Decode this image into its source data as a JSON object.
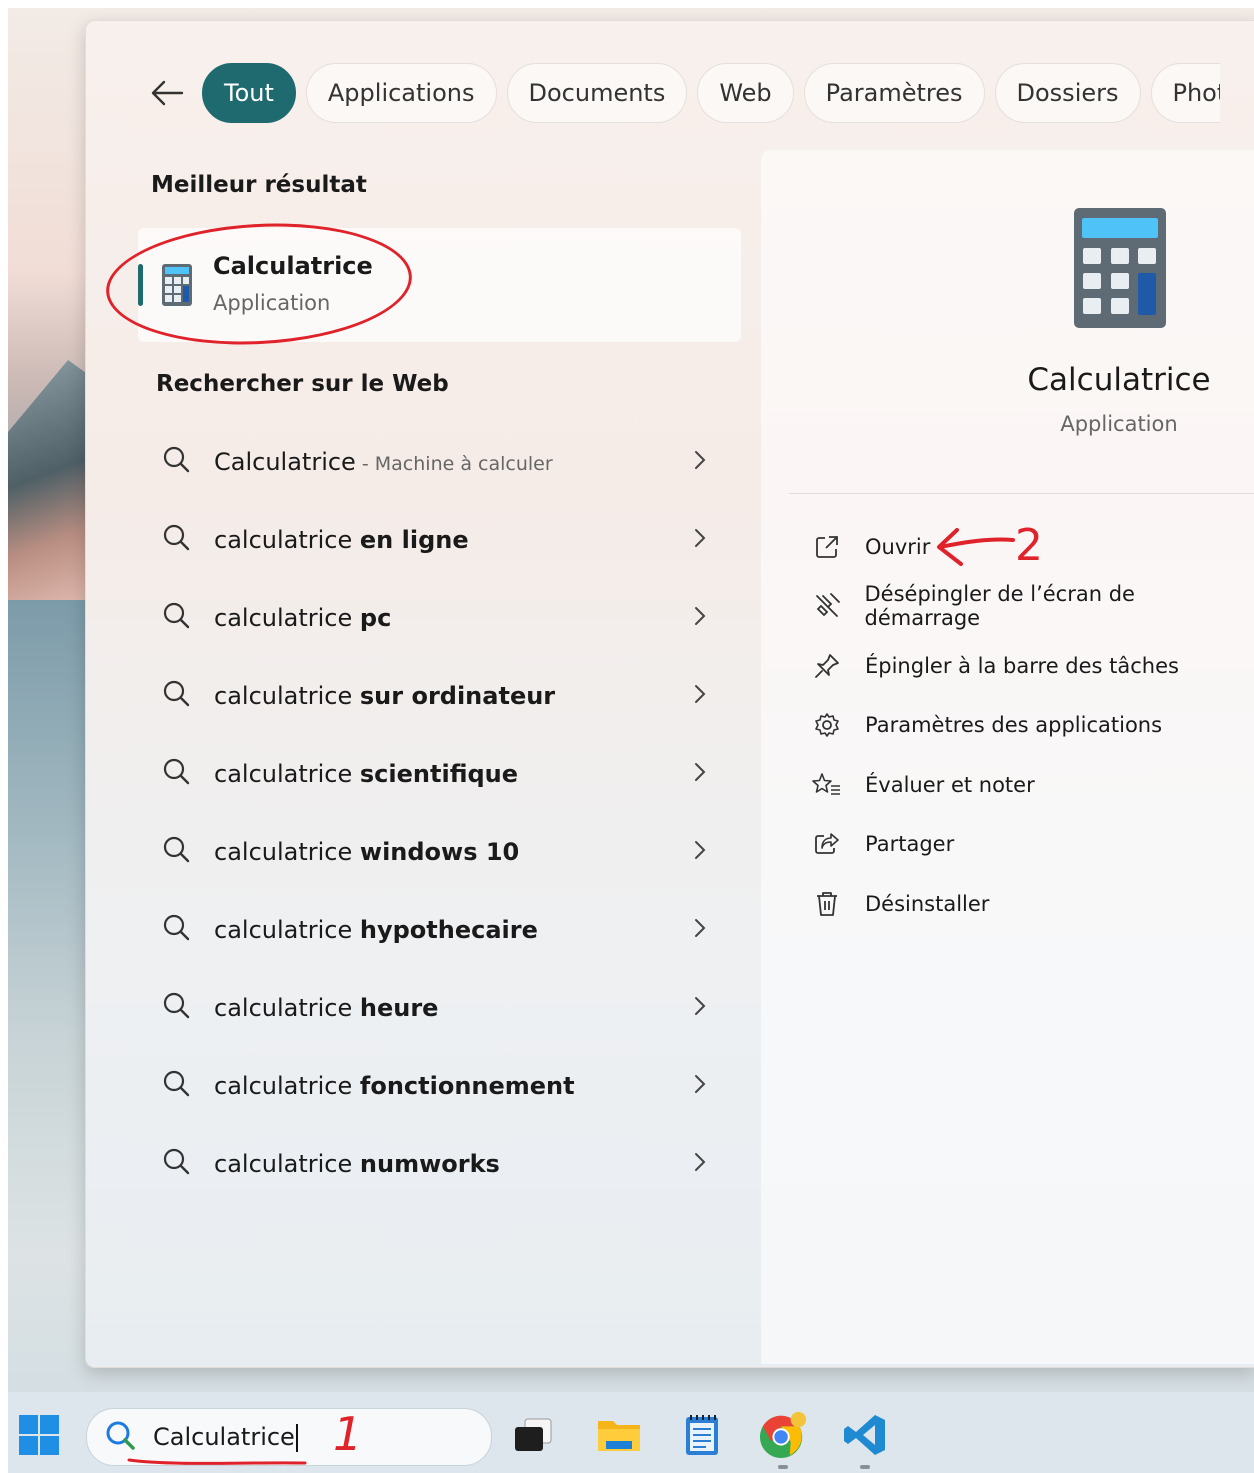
{
  "filters": {
    "back_icon": "arrow-left-icon",
    "items": [
      "Tout",
      "Applications",
      "Documents",
      "Web",
      "Paramètres",
      "Dossiers",
      "Photc"
    ],
    "active": "Tout"
  },
  "best_result": {
    "heading": "Meilleur résultat",
    "name": "Calculatrice",
    "type": "Application"
  },
  "web_search": {
    "heading": "Rechercher sur le Web",
    "rows": [
      {
        "prefix": "Calculatrice",
        "bold": "",
        "sub": " - Machine à calculer"
      },
      {
        "prefix": "calculatrice ",
        "bold": "en ligne",
        "sub": ""
      },
      {
        "prefix": "calculatrice ",
        "bold": "pc",
        "sub": ""
      },
      {
        "prefix": "calculatrice ",
        "bold": "sur ordinateur",
        "sub": ""
      },
      {
        "prefix": "calculatrice ",
        "bold": "scientifique",
        "sub": ""
      },
      {
        "prefix": "calculatrice ",
        "bold": "windows 10",
        "sub": ""
      },
      {
        "prefix": "calculatrice ",
        "bold": "hypothecaire",
        "sub": ""
      },
      {
        "prefix": "calculatrice ",
        "bold": "heure",
        "sub": ""
      },
      {
        "prefix": "calculatrice ",
        "bold": "fonctionnement",
        "sub": ""
      },
      {
        "prefix": "calculatrice ",
        "bold": "numworks",
        "sub": ""
      }
    ]
  },
  "detail": {
    "name": "Calculatrice",
    "type": "Application",
    "actions": [
      {
        "label": "Ouvrir",
        "icon": "open-external-icon"
      },
      {
        "label": "Désépingler de l’écran de démarrage",
        "icon": "unpin-icon"
      },
      {
        "label": "Épingler à la barre des tâches",
        "icon": "pin-icon"
      },
      {
        "label": "Paramètres des applications",
        "icon": "gear-icon"
      },
      {
        "label": "Évaluer et noter",
        "icon": "star-rate-icon"
      },
      {
        "label": "Partager",
        "icon": "share-icon"
      },
      {
        "label": "Désinstaller",
        "icon": "trash-icon"
      }
    ]
  },
  "annotations": {
    "one": "1",
    "two": "2",
    "color": "#e0222a"
  },
  "taskbar": {
    "search_value": "Calculatrice",
    "icons": [
      "windows-start-icon",
      "task-view-icon",
      "file-explorer-icon",
      "notepad-icon",
      "chrome-icon",
      "vscode-icon"
    ]
  },
  "colors": {
    "accent": "#1e6a6f",
    "annotation": "#e0222a"
  }
}
